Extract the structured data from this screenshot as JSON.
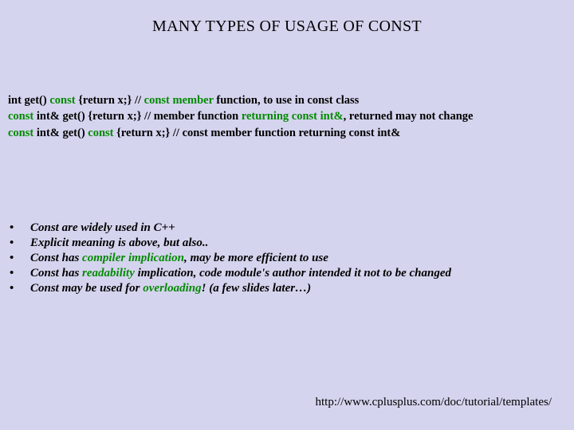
{
  "title": "MANY TYPES OF USAGE OF CONST",
  "code": {
    "l1a": "int  get()  ",
    "l1b": "const",
    "l1c": " {return x;}        // ",
    "l1d": "const member",
    "l1e": " function, to use in const class",
    "l2a": "const",
    "l2b": "  int&  get() {return x;}        // member function ",
    "l2c": "returning const int&",
    "l2d": ", returned may not change",
    "l3a": "const",
    "l3b": "  int&  get()  ",
    "l3c": "const",
    "l3d": " {return x;} // const member function returning const int&"
  },
  "bullets": {
    "b1": "Const are widely used in C++",
    "b2a": "Explicit meaning is above, but also..",
    "b3a": "Const has ",
    "b3b": "compiler implication",
    "b3c": ", may be more efficient to use",
    "b4a": "Const has ",
    "b4b": "readability",
    "b4c": " implication, code module's author intended it not to be changed",
    "b5a": "Const may be used for ",
    "b5b": "overloading",
    "b5c": "! (a few slides later…)"
  },
  "footer": "http://www.cplusplus.com/doc/tutorial/templates/"
}
